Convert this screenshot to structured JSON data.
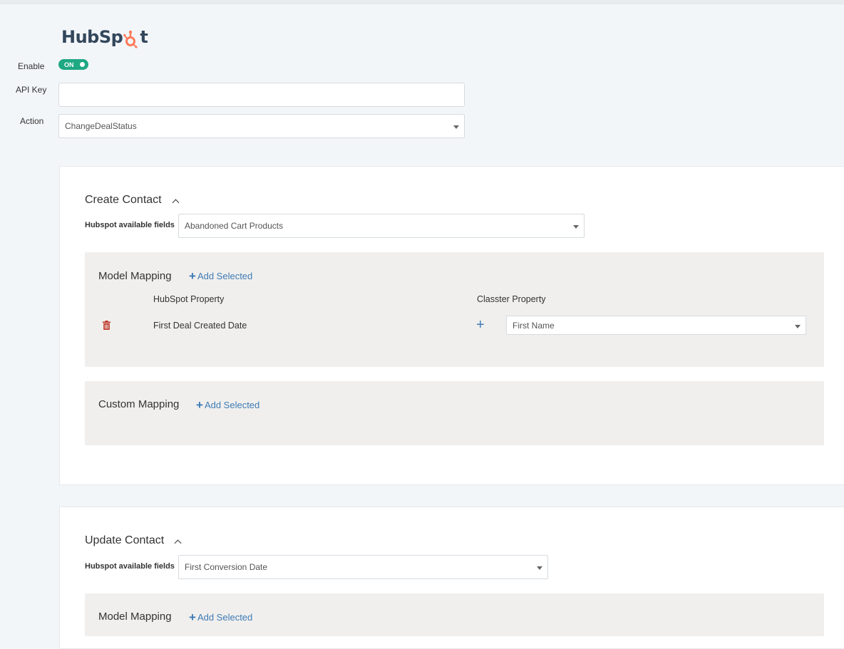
{
  "logo": {
    "text_left": "HubSp",
    "text_right": "t",
    "accent_color": "#ff7a59"
  },
  "settings": {
    "enable_label": "Enable",
    "toggle_label": "ON",
    "api_key_label": "API Key",
    "api_key_value": "",
    "action_label": "Action",
    "action_value": "ChangeDealStatus"
  },
  "create_contact": {
    "title": "Create Contact",
    "fields_label": "Hubspot available fields",
    "fields_value": "Abandoned Cart Products",
    "model_mapping": {
      "title": "Model Mapping",
      "add_label": "Add Selected",
      "col_hubspot": "HubSpot Property",
      "col_classter": "Classter Property",
      "rows": [
        {
          "hubspot_property": "First Deal Created Date",
          "classter_property": "First Name"
        }
      ]
    },
    "custom_mapping": {
      "title": "Custom Mapping",
      "add_label": "Add Selected"
    }
  },
  "update_contact": {
    "title": "Update Contact",
    "fields_label": "Hubspot available fields",
    "fields_value": "First Conversion Date",
    "model_mapping": {
      "title": "Model Mapping",
      "add_label": "Add Selected"
    }
  },
  "colors": {
    "toggle_on": "#1ea883",
    "link": "#3f7bb5",
    "delete": "#c0392b",
    "panel_bg": "#f0efed"
  }
}
